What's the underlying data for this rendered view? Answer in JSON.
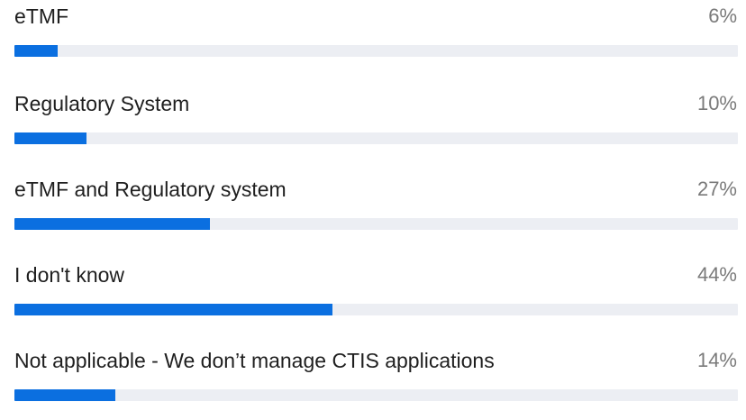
{
  "poll": {
    "accent_color": "#0b6fe0",
    "options": [
      {
        "label": "eTMF",
        "percent_text": "6%",
        "percent_value": 6
      },
      {
        "label": "Regulatory System",
        "percent_text": "10%",
        "percent_value": 10
      },
      {
        "label": "eTMF and Regulatory system",
        "percent_text": "27%",
        "percent_value": 27
      },
      {
        "label": "I don't know",
        "percent_text": "44%",
        "percent_value": 44
      },
      {
        "label": "Not applicable - We don’t manage CTIS applications",
        "percent_text": "14%",
        "percent_value": 14
      }
    ]
  }
}
